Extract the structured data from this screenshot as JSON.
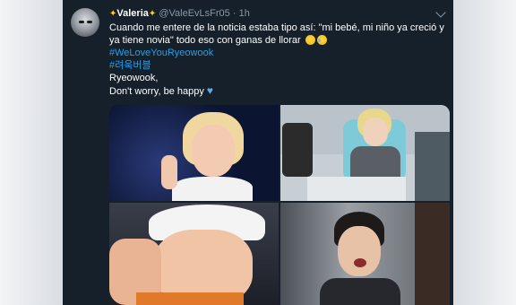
{
  "tweet": {
    "display_name": "Valeria",
    "handle": "@ValeEvLsFr05",
    "separator": "·",
    "time": "1h",
    "lines": [
      "Cuando me entere de la noticia estaba tipo así: \"mi bebé, mi niño ya creció y",
      "ya tiene novia\" todo eso con ganas de llorar"
    ],
    "hashtag": "#WeLoveYouRyeowook",
    "korean_hashtag": "#려욱버블",
    "line_name": "Ryeowook,",
    "line_worry": "Don't worry, be happy"
  },
  "icons": {
    "sparkle": "sparkles-emoji",
    "crying_face": "crying-face-emoji",
    "tears_of_joy": "tears-of-joy-emoji",
    "heart": "blue-heart-emoji",
    "more": "chevron-down-icon"
  },
  "colors": {
    "background": "#15202b",
    "link": "#1da1f2",
    "secondary_text": "#8899a6"
  }
}
